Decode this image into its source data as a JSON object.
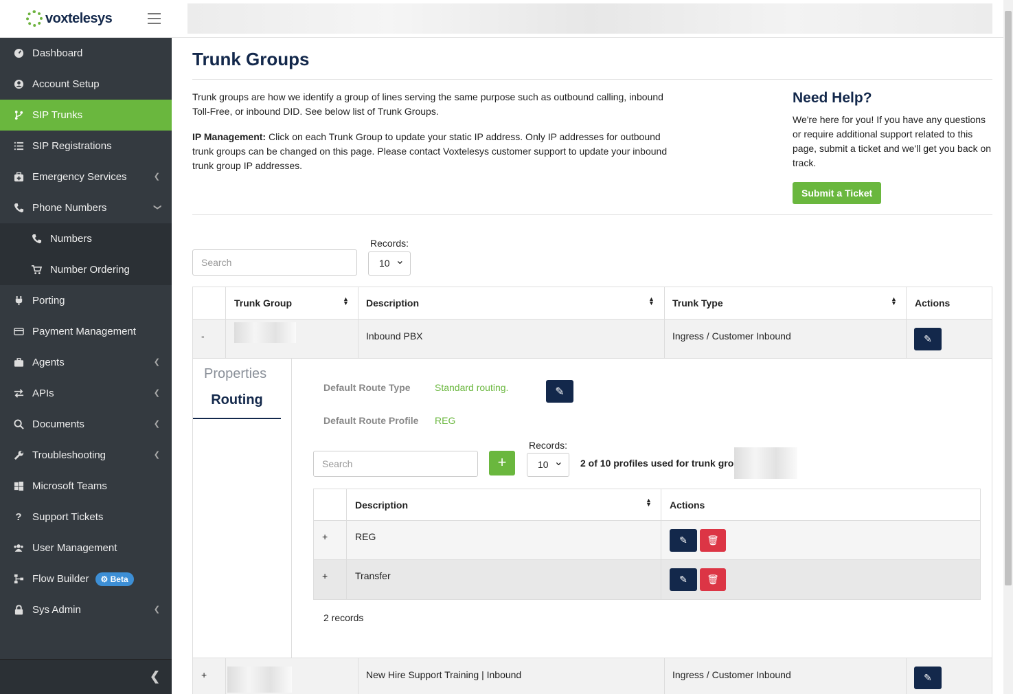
{
  "brand": {
    "logo_text": "voxtelesys"
  },
  "sidebar": {
    "items": [
      {
        "label": "Dashboard",
        "icon": "dashboard-icon"
      },
      {
        "label": "Account Setup",
        "icon": "user-circle-icon"
      },
      {
        "label": "SIP Trunks",
        "icon": "branch-icon",
        "active": true
      },
      {
        "label": "SIP Registrations",
        "icon": "list-icon"
      },
      {
        "label": "Emergency Services",
        "icon": "medkit-icon"
      },
      {
        "label": "Phone Numbers",
        "icon": "phone-icon"
      },
      {
        "label": "Numbers",
        "icon": "phone-icon"
      },
      {
        "label": "Number Ordering",
        "icon": "cart-icon"
      },
      {
        "label": "Porting",
        "icon": "plug-icon"
      },
      {
        "label": "Payment Management",
        "icon": "credit-card-icon"
      },
      {
        "label": "Agents",
        "icon": "briefcase-icon"
      },
      {
        "label": "APIs",
        "icon": "exchange-icon"
      },
      {
        "label": "Documents",
        "icon": "search-icon"
      },
      {
        "label": "Troubleshooting",
        "icon": "wrench-icon"
      },
      {
        "label": "Microsoft Teams",
        "icon": "windows-icon"
      },
      {
        "label": "Support Tickets",
        "icon": "question-icon"
      },
      {
        "label": "User Management",
        "icon": "users-icon"
      },
      {
        "label": "Flow Builder",
        "icon": "sitemap-icon",
        "badge": "Beta"
      },
      {
        "label": "Sys Admin",
        "icon": "lock-icon"
      }
    ]
  },
  "page": {
    "title": "Trunk Groups",
    "intro": "Trunk groups are how we identify a group of lines serving the same purpose such as outbound calling, inbound Toll-Free, or inbound DID. See below list of Trunk Groups.",
    "ip_label": "IP Management:",
    "ip_text": " Click on each Trunk Group to update your static IP address. Only IP addresses for outbound trunk groups can be changed on this page. Please contact Voxtelesys customer support to update your inbound trunk group IP addresses."
  },
  "help": {
    "title": "Need Help?",
    "text": "We're here for you! If you have any questions or require additional support related to this page, submit a ticket and we'll get you back on track.",
    "button": "Submit a Ticket"
  },
  "table": {
    "search_placeholder": "Search",
    "records_label": "Records:",
    "records_value": "10",
    "headers": {
      "trunk_group": "Trunk Group",
      "description": "Description",
      "trunk_type": "Trunk Type",
      "actions": "Actions"
    },
    "rows": [
      {
        "toggle": "-",
        "description": "Inbound PBX",
        "trunk_type": "Ingress / Customer Inbound"
      },
      {
        "toggle": "+",
        "description": "New Hire Support Training | Inbound",
        "trunk_type": "Ingress / Customer Inbound"
      }
    ]
  },
  "detail": {
    "tabs": {
      "properties": "Properties",
      "routing": "Routing"
    },
    "default_route_type_label": "Default Route Type",
    "default_route_type_value": "Standard routing.",
    "default_route_profile_label": "Default Route Profile",
    "default_route_profile_value": "REG",
    "search_placeholder": "Search",
    "add_label": "+",
    "records_label": "Records:",
    "records_value": "10",
    "profiles_used": "2 of 10 profiles used for trunk group",
    "headers": {
      "description": "Description",
      "actions": "Actions"
    },
    "rows": [
      {
        "toggle": "+",
        "description": "REG"
      },
      {
        "toggle": "+",
        "description": "Transfer"
      }
    ],
    "record_count": "2 records"
  },
  "colors": {
    "accent_green": "#6ab73e",
    "navy": "#13284b",
    "danger": "#dc3545",
    "sidebar": "#343a40"
  }
}
